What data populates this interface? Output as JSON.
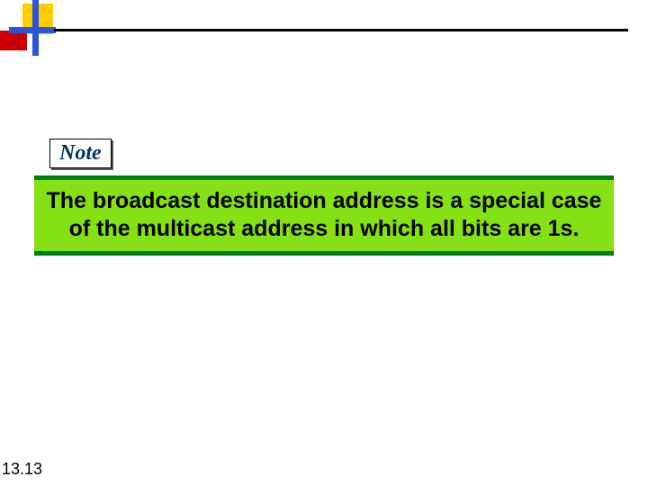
{
  "note": {
    "label": "Note",
    "body": "The broadcast destination address is a special case of the multicast address in which all bits are 1s."
  },
  "page_number": "13.13"
}
